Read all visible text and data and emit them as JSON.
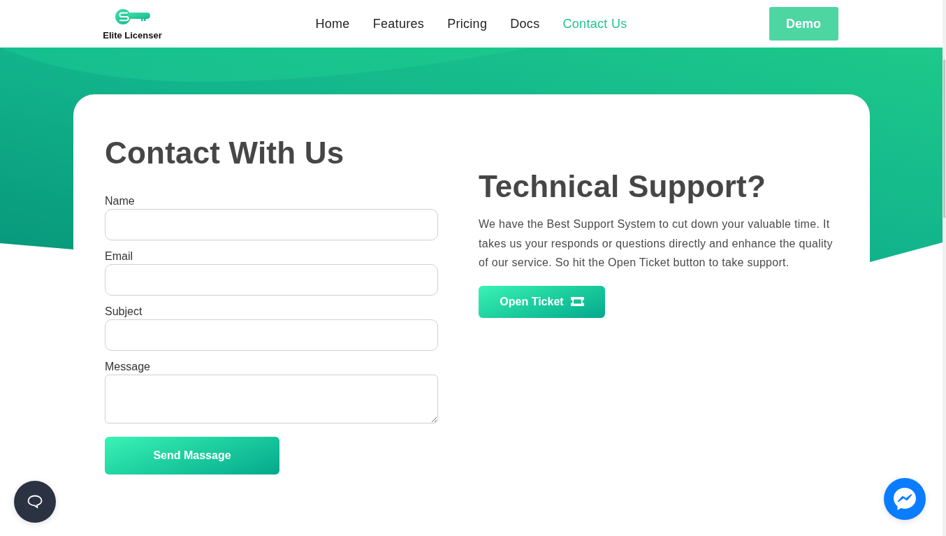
{
  "navbar": {
    "logo_text": "Elite Licenser",
    "links": [
      {
        "label": "Home",
        "selected": false
      },
      {
        "label": "Features",
        "selected": false
      },
      {
        "label": "Pricing",
        "selected": false
      },
      {
        "label": "Docs",
        "selected": false
      },
      {
        "label": "Contact Us",
        "selected": true
      }
    ],
    "demo_button": "Demo"
  },
  "contact_form": {
    "title": "Contact With Us",
    "fields": [
      {
        "label": "Name",
        "kind": "input"
      },
      {
        "label": "Email",
        "kind": "input"
      },
      {
        "label": "Subject",
        "kind": "input"
      },
      {
        "label": "Message",
        "kind": "textarea"
      }
    ],
    "submit_button": "Send Massage"
  },
  "support": {
    "title": "Technical Support?",
    "text": "We have the Best Support System to cut down your valuable time. It takes us your responds or questions directly and enhance the quality of our service. So hit the Open Ticket button to take support.",
    "button": "Open Ticket"
  }
}
